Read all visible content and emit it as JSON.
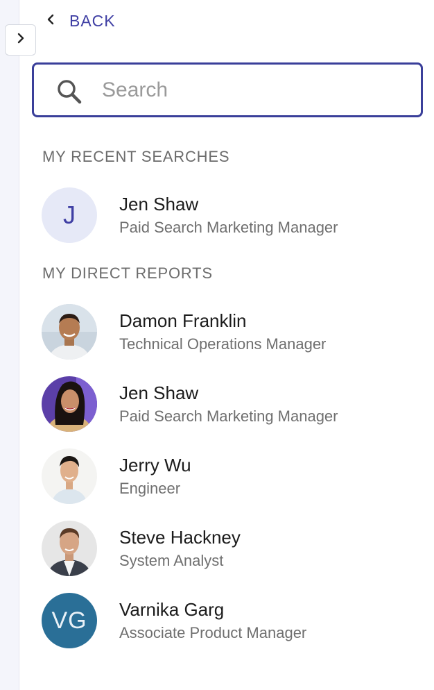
{
  "nav": {
    "back_label": "BACK"
  },
  "search": {
    "placeholder": "Search",
    "value": ""
  },
  "recent_searches": {
    "title": "MY RECENT SEARCHES",
    "items": [
      {
        "initial": "J",
        "name": "Jen Shaw",
        "role": "Paid Search Marketing Manager"
      }
    ]
  },
  "direct_reports": {
    "title": "MY DIRECT REPORTS",
    "items": [
      {
        "name": "Damon Franklin",
        "role": "Technical Operations Manager",
        "avatar": "photo"
      },
      {
        "name": "Jen Shaw",
        "role": "Paid Search Marketing Manager",
        "avatar": "photo"
      },
      {
        "name": "Jerry Wu",
        "role": "Engineer",
        "avatar": "photo"
      },
      {
        "name": "Steve Hackney",
        "role": "System Analyst",
        "avatar": "photo"
      },
      {
        "name": "Varnika Garg",
        "role": "Associate Product Manager",
        "avatar": "initials",
        "initials": "VG"
      }
    ]
  },
  "colors": {
    "accent": "#3f3fa4",
    "search_border": "#3a3f9a",
    "vg_avatar_bg": "#2a6f97",
    "initial_avatar_bg": "#e6e9f7"
  }
}
